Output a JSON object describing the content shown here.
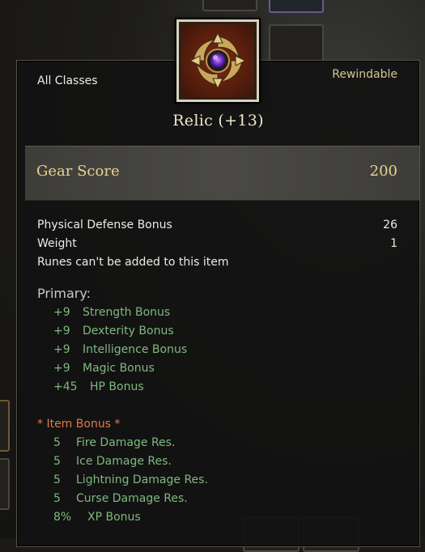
{
  "tooltip": {
    "classes": "All Classes",
    "status": "Rewindable",
    "item_name": "Relic (+13)",
    "icon": "relic-emblem-icon",
    "gear_score_label": "Gear Score",
    "gear_score_value": "200",
    "properties": [
      {
        "label": "Physical Defense Bonus",
        "value": "26"
      },
      {
        "label": "Weight",
        "value": "1"
      },
      {
        "label": "Runes can't be added to this item",
        "value": ""
      }
    ],
    "primary_header": "Primary:",
    "primary_stats": [
      {
        "amount": "+9",
        "name": "Strength Bonus"
      },
      {
        "amount": "+9",
        "name": "Dexterity Bonus"
      },
      {
        "amount": "+9",
        "name": "Intelligence Bonus"
      },
      {
        "amount": "+9",
        "name": "Magic Bonus"
      },
      {
        "amount": "+45",
        "name": "HP Bonus"
      }
    ],
    "item_bonus_header": "*  Item Bonus *",
    "item_bonus_stats": [
      {
        "amount": "5",
        "name": "Fire Damage Res."
      },
      {
        "amount": "5",
        "name": "Ice Damage Res."
      },
      {
        "amount": "5",
        "name": "Lightning Damage Res."
      },
      {
        "amount": "5",
        "name": "Curse Damage Res."
      },
      {
        "amount": "8%",
        "name": "XP Bonus"
      }
    ]
  },
  "colors": {
    "stat_green": "#7fb87f",
    "bonus_orange": "#e07a4a",
    "gold": "#e9d291",
    "rewind_gold": "#d8c590"
  }
}
